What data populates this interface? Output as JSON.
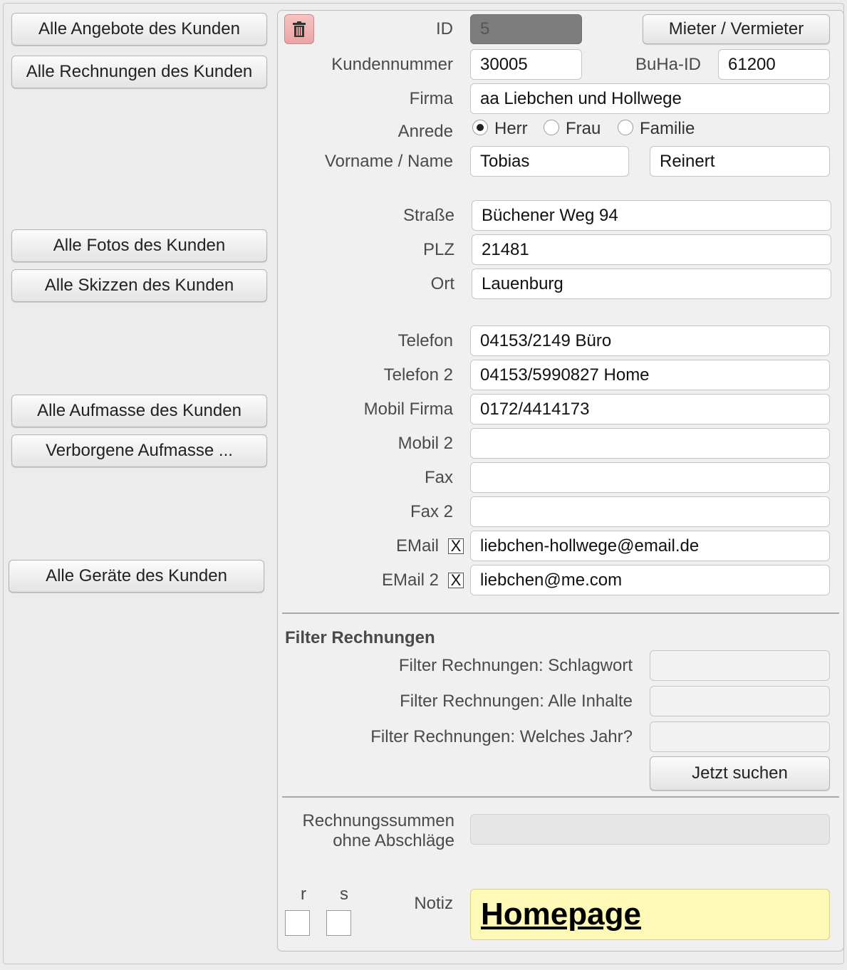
{
  "left_buttons": {
    "angebote": "Alle Angebote des Kunden",
    "rechnungen": "Alle Rechnungen des Kunden",
    "fotos": "Alle Fotos des Kunden",
    "skizzen": "Alle Skizzen des Kunden",
    "aufmasse": "Alle Aufmasse des Kunden",
    "verborgene": "Verborgene Aufmasse ...",
    "geraete": "Alle Geräte des Kunden"
  },
  "form": {
    "id_label": "ID",
    "id_value": "5",
    "mieter_button": "Mieter / Vermieter",
    "kundennummer_label": "Kundennummer",
    "kundennummer_value": "30005",
    "buha_label": "BuHa-ID",
    "buha_value": "61200",
    "firma_label": "Firma",
    "firma_value": "aa Liebchen und Hollwege",
    "anrede_label": "Anrede",
    "anrede_options": [
      "Herr",
      "Frau",
      "Familie"
    ],
    "anrede_selected": "Herr",
    "name_label": "Vorname / Name",
    "vorname_value": "Tobias",
    "nachname_value": "Reinert",
    "strasse_label": "Straße",
    "strasse_value": "Büchener Weg 94",
    "plz_label": "PLZ",
    "plz_value": "21481",
    "ort_label": "Ort",
    "ort_value": "Lauenburg",
    "telefon_label": "Telefon",
    "telefon_value": "04153/2149 Büro",
    "telefon2_label": "Telefon 2",
    "telefon2_value": "04153/5990827 Home",
    "mobil_firma_label": "Mobil Firma",
    "mobil_firma_value": "0172/4414173",
    "mobil2_label": "Mobil 2",
    "mobil2_value": "",
    "fax_label": "Fax",
    "fax_value": "",
    "fax2_label": "Fax 2",
    "fax2_value": "",
    "email_label": "EMail",
    "email_checked": "X",
    "email_value": "liebchen-hollwege@email.de",
    "email2_label": "EMail 2",
    "email2_checked": "X",
    "email2_value": "liebchen@me.com"
  },
  "filter": {
    "title": "Filter Rechnungen",
    "schlagwort_label": "Filter Rechnungen: Schlagwort",
    "inhalte_label": "Filter Rechnungen: Alle Inhalte",
    "jahr_label": "Filter Rechnungen: Welches Jahr?",
    "search_button": "Jetzt suchen"
  },
  "summen": {
    "label_line1": "Rechnungssummen",
    "label_line2": "ohne Abschläge",
    "value": ""
  },
  "bottom": {
    "r_label": "r",
    "s_label": "s",
    "notiz_label": "Notiz",
    "notiz_value": "Homepage"
  },
  "colors": {
    "note_background": "#fef9b7",
    "delete_button": "#eba3a3"
  },
  "icons": {
    "delete": "trash-icon"
  }
}
